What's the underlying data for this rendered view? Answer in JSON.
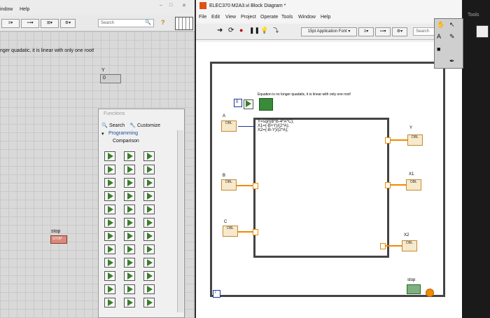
{
  "front_panel": {
    "menu": [
      "indow",
      "Help"
    ],
    "search_placeholder": "Search",
    "help_icon": "?",
    "caption_text": "nger quadatic, it is linear with only one root!",
    "y_indicator_label": "Y",
    "y_indicator_value": "0",
    "stop_label": "stop",
    "stop_button_text": "STOP"
  },
  "palette": {
    "title": "Functions",
    "search_label": "Search",
    "customize_label": "Customize",
    "tree_programming": "Programming",
    "tree_comparison": "Comparison"
  },
  "block_diagram": {
    "title": "ELEC370 M2A3.vi Block Diagram *",
    "menu": [
      "File",
      "Edit",
      "View",
      "Project",
      "Operate",
      "Tools",
      "Window",
      "Help"
    ],
    "font_selector": "15pt Application Font",
    "search_placeholder": "Search",
    "tools_label": "Tools",
    "string_constant": "Equation is no longer quadatic, it is linear with only one root!",
    "zero_constant": "0",
    "formula_lines": [
      "Y=sqrt(B*B-4*A*C);",
      "X1=(-B+Y)/(2*A);",
      "X2=(-B-Y)/(2*A);"
    ],
    "label_a": "A",
    "label_b": "B",
    "label_c": "C",
    "label_y": "Y",
    "label_x1": "X1",
    "label_x2": "X2",
    "label_stop": "stop",
    "node_type": "DBL",
    "loop_iteration": "i"
  },
  "colors": {
    "wire": "#f08a00",
    "node_fill": "#f7e9c9",
    "node_border": "#c28b3a",
    "structure": "#444444"
  }
}
